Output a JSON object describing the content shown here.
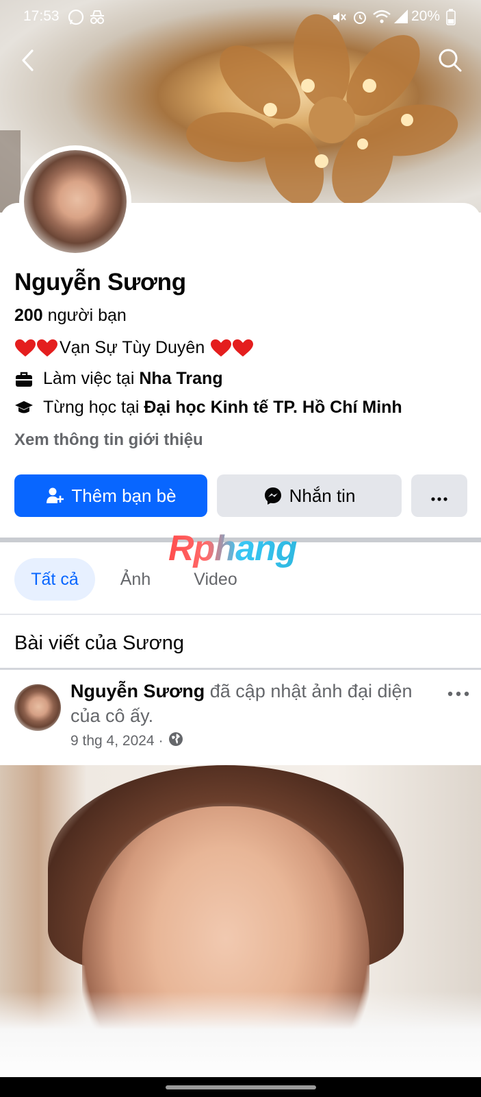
{
  "status_bar": {
    "time": "17:53",
    "battery": "20%"
  },
  "profile": {
    "name": "Nguyễn Sương",
    "friends_count": "200",
    "friends_label": " người bạn",
    "bio_text": "Vạn Sự Tùy Duyên",
    "work_prefix": "Làm việc tại ",
    "work_place": "Nha Trang",
    "study_prefix": "Từng học tại ",
    "study_place": "Đại học Kinh tế TP. Hồ Chí Minh",
    "about_link": "Xem thông tin giới thiệu"
  },
  "actions": {
    "add_friend": "Thêm bạn bè",
    "message": "Nhắn tin"
  },
  "watermark": "Rphang",
  "tabs": [
    {
      "label": "Tất cả",
      "active": true
    },
    {
      "label": "Ảnh",
      "active": false
    },
    {
      "label": "Video",
      "active": false
    }
  ],
  "posts_section": {
    "title": "Bài viết của Sương"
  },
  "post": {
    "author": "Nguyễn Sương",
    "action_text": " đã cập nhật ảnh đại diện của cô ấy.",
    "date": "9 thg 4, 2024",
    "separator": "·",
    "privacy_icon": "globe-icon"
  },
  "colors": {
    "accent": "#0866ff",
    "secondary_bg": "#e4e6eb",
    "muted_text": "#65676b"
  }
}
